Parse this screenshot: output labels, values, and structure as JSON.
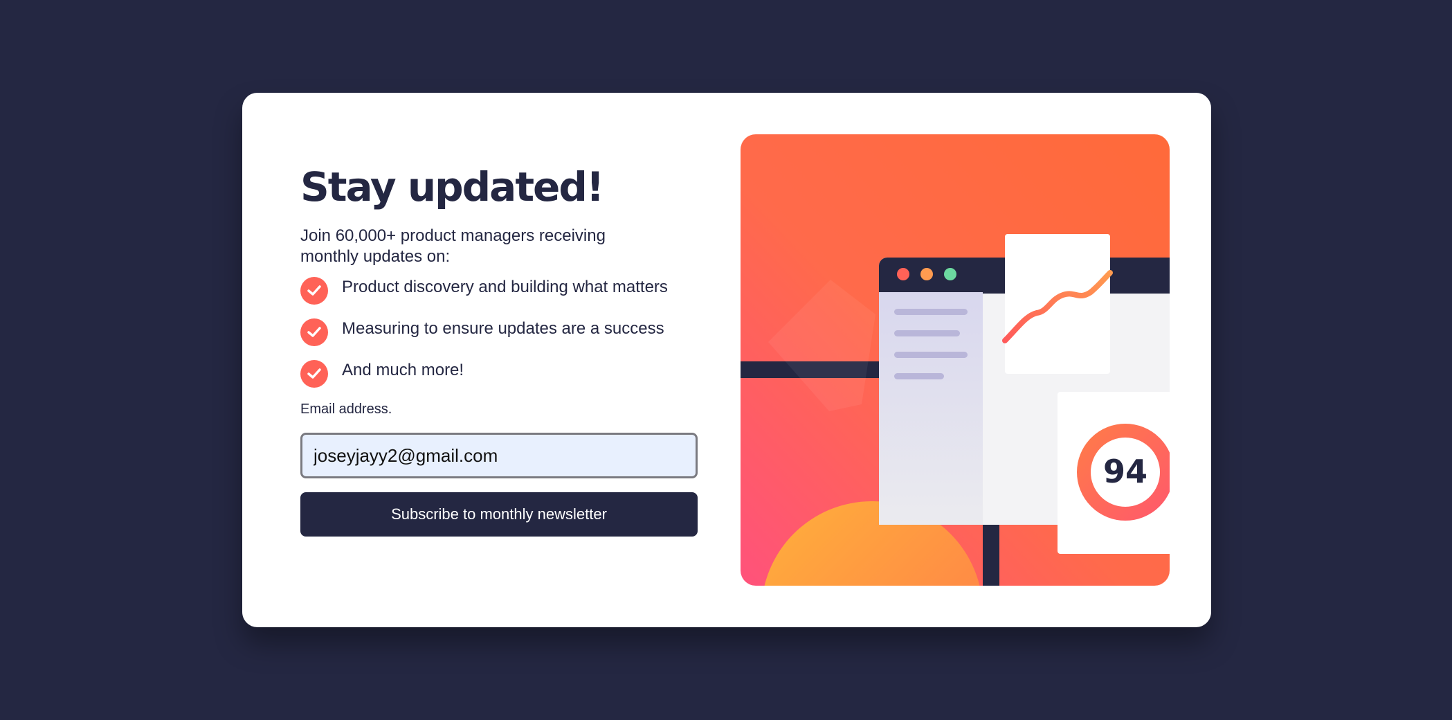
{
  "heading": "Stay updated!",
  "intro": "Join 60,000+ product managers receiving monthly updates on:",
  "features": [
    "Product discovery and building what matters",
    "Measuring to ensure updates are a success",
    "And much more!"
  ],
  "form": {
    "email_label": "Email address.",
    "email_value": "joseyjayy2@gmail.com",
    "submit_label": "Subscribe to monthly newsletter"
  },
  "illustration": {
    "score": "94",
    "window_dot_colors": [
      "#ff6257",
      "#ff9b50",
      "#6cd9a0"
    ]
  },
  "colors": {
    "background": "#242742",
    "accent": "#ff6257",
    "text": "#242742"
  },
  "icons": [
    "checkmark-icon"
  ]
}
